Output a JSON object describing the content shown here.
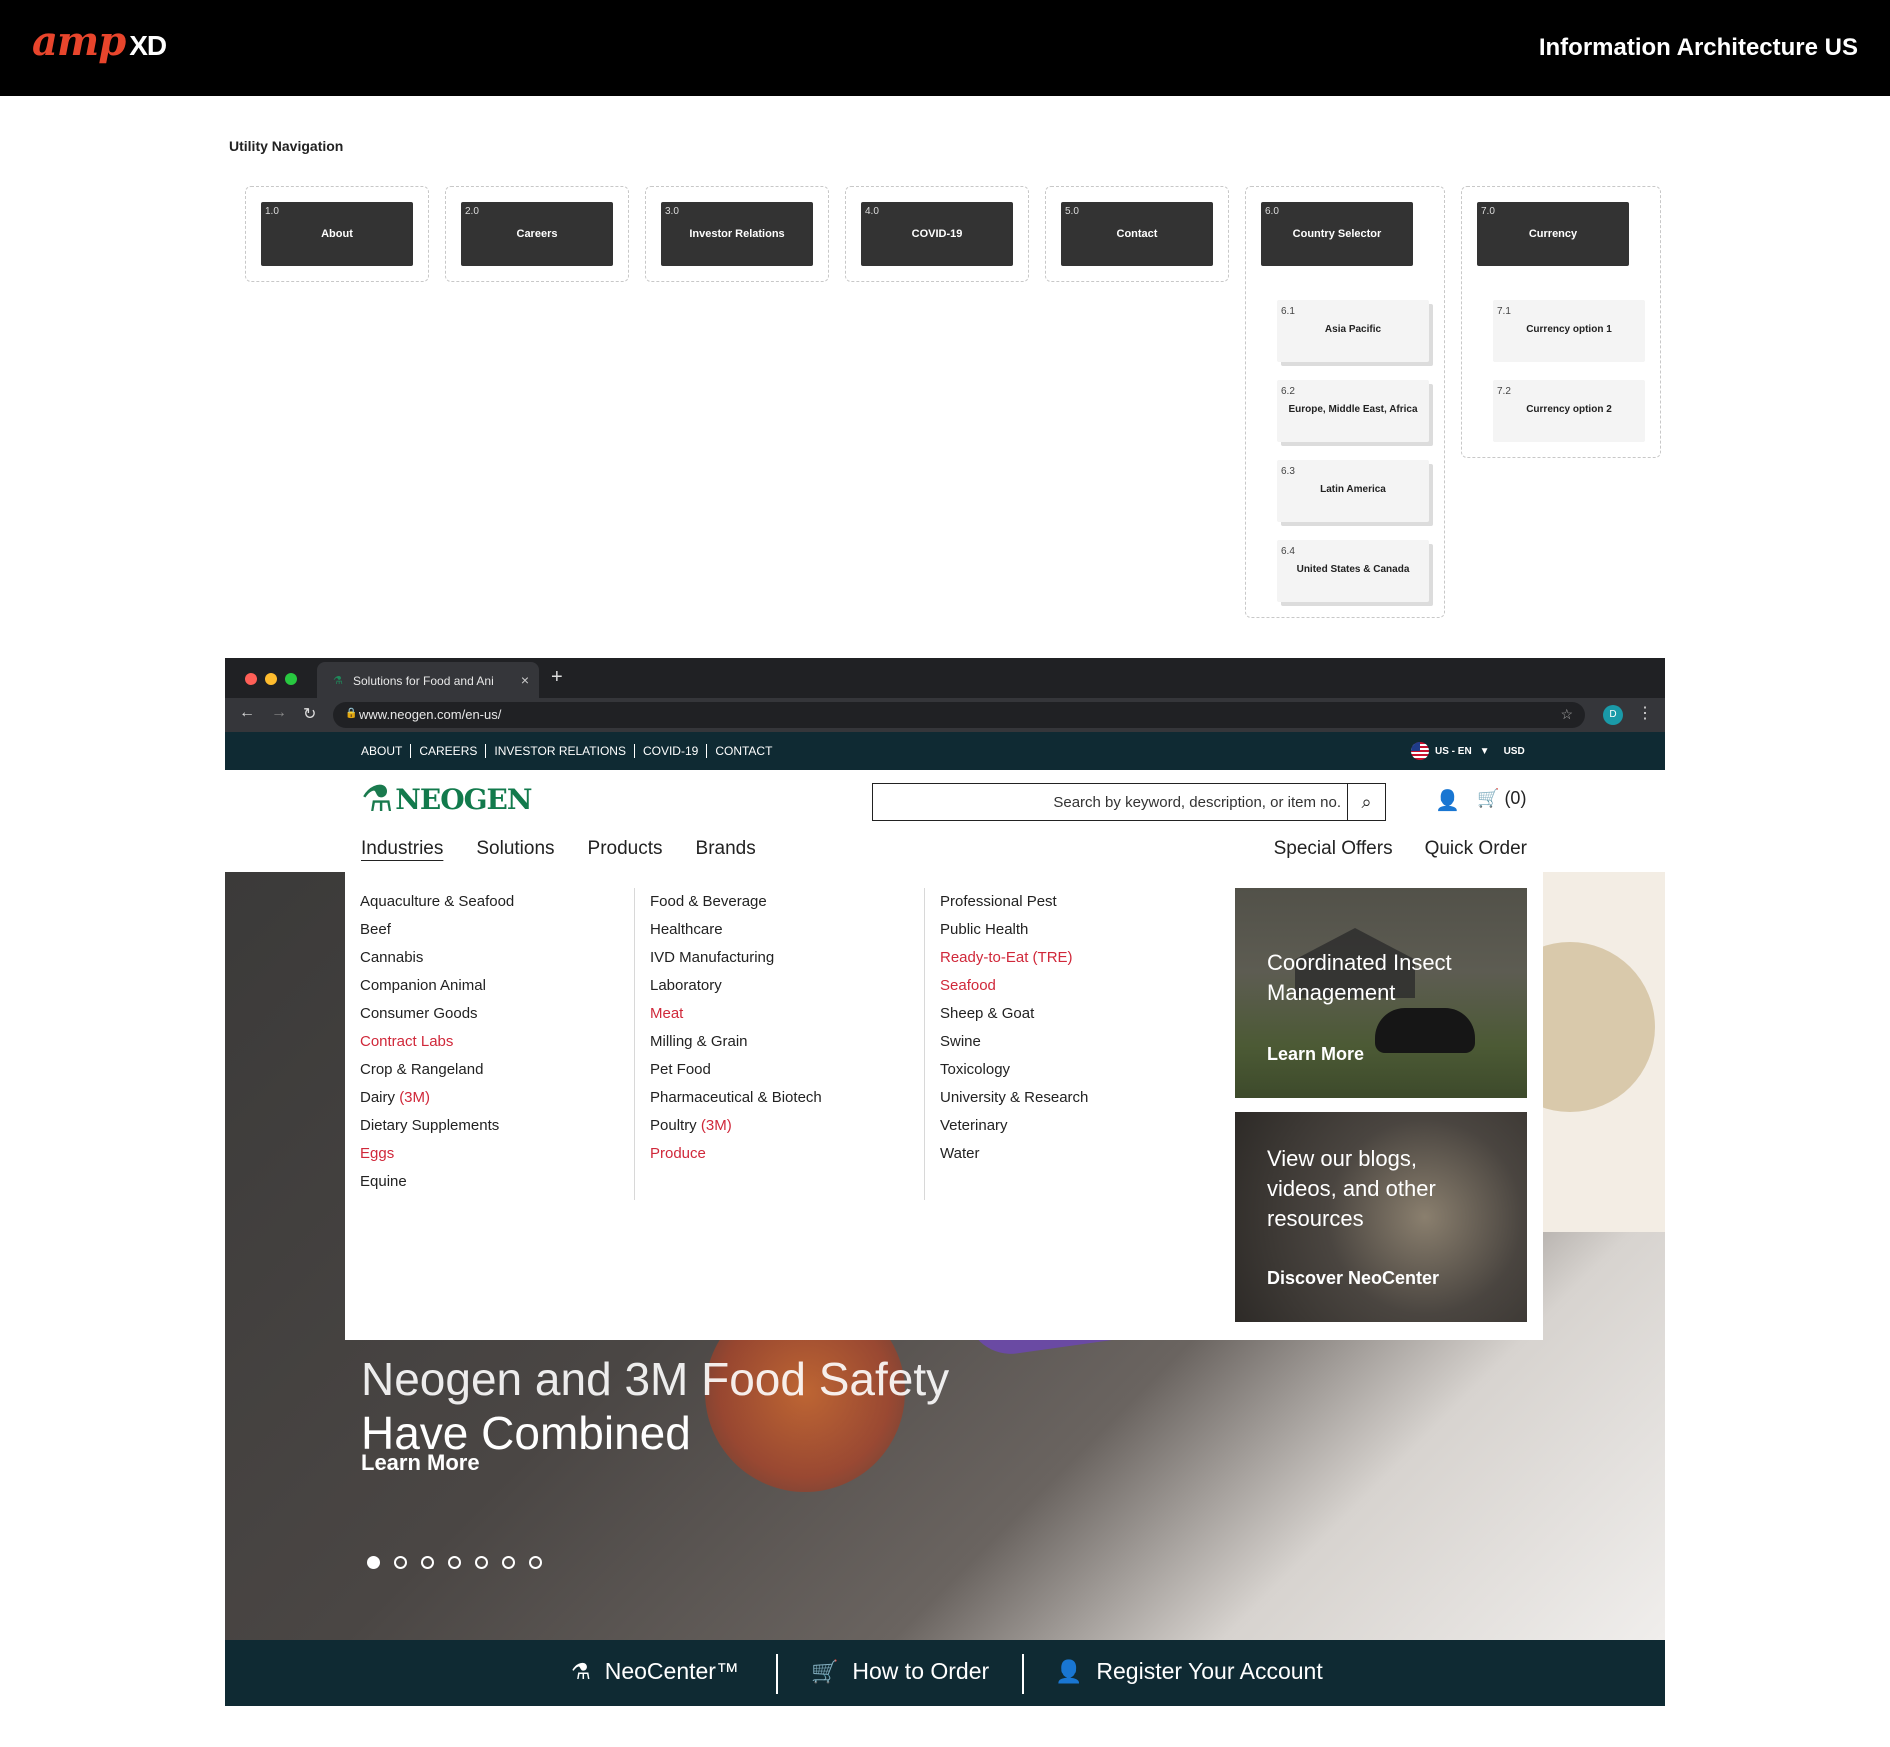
{
  "header": {
    "logo_text": "amp",
    "logo_suffix": "XD",
    "title": "Information Architecture US"
  },
  "ia": {
    "section_label": "Utility Navigation",
    "nodes": [
      {
        "num": "1.0",
        "label": "About"
      },
      {
        "num": "2.0",
        "label": "Careers"
      },
      {
        "num": "3.0",
        "label": "Investor Relations"
      },
      {
        "num": "4.0",
        "label": "COVID-19"
      },
      {
        "num": "5.0",
        "label": "Contact"
      },
      {
        "num": "6.0",
        "label": "Country Selector"
      },
      {
        "num": "7.0",
        "label": "Currency"
      }
    ],
    "country_children": [
      {
        "num": "6.1",
        "label": "Asia Pacific"
      },
      {
        "num": "6.2",
        "label": "Europe, Middle East, Africa"
      },
      {
        "num": "6.3",
        "label": "Latin America"
      },
      {
        "num": "6.4",
        "label": "United States & Canada"
      }
    ],
    "currency_children": [
      {
        "num": "7.1",
        "label": "Currency option 1"
      },
      {
        "num": "7.2",
        "label": "Currency option 2"
      }
    ]
  },
  "browser": {
    "tab_title": "Solutions for Food and Ani",
    "url": "www.neogen.com/en-us/",
    "profile_initial": "D"
  },
  "site": {
    "utility_links": [
      "ABOUT",
      "CAREERS",
      "INVESTOR RELATIONS",
      "COVID-19",
      "CONTACT"
    ],
    "region": "US - EN",
    "currency": "USD",
    "brand": "NEOGEN",
    "search_placeholder": "Search by keyword, description, or item no.",
    "cart_count": "(0)",
    "main_nav": [
      "Industries",
      "Solutions",
      "Products",
      "Brands"
    ],
    "right_nav": [
      "Special Offers",
      "Quick Order"
    ],
    "hero": {
      "headline_line1": "Neogen and 3M Food Safety",
      "headline_line2": "Have Combined",
      "cta": "Learn More"
    },
    "mega": {
      "col1": [
        "Aquaculture & Seafood",
        "Beef",
        "Cannabis",
        "Companion Animal",
        "Consumer Goods",
        "Contract Labs",
        "Crop & Rangeland",
        "Dairy",
        "Dietary Supplements",
        "Eggs",
        "Equine"
      ],
      "col2": [
        "Food & Beverage",
        "Healthcare",
        "IVD Manufacturing",
        "Laboratory",
        "Meat",
        "Milling & Grain",
        "Pet Food",
        "Pharmaceutical & Biotech",
        "Poultry",
        "Produce"
      ],
      "col3": [
        "Professional Pest",
        "Public Health",
        "Ready-to-Eat (TRE)",
        "Seafood",
        "Sheep & Goat",
        "Swine",
        "Toxicology",
        "University & Research",
        "Veterinary",
        "Water"
      ],
      "tag_3m": "(3M)",
      "promo1_title": "Coordinated Insect Management",
      "promo1_link": "Learn More",
      "promo2_title": "View our blogs, videos, and other resources",
      "promo2_link": "Discover NeoCenter"
    },
    "footer": [
      "NeoCenter™",
      "How to Order",
      "Register Your Account"
    ]
  },
  "colors": {
    "brand_green": "#127a4c",
    "accent_red": "#d0283a",
    "dark_teal": "#0f2a33",
    "amp_orange": "#e8452c"
  }
}
